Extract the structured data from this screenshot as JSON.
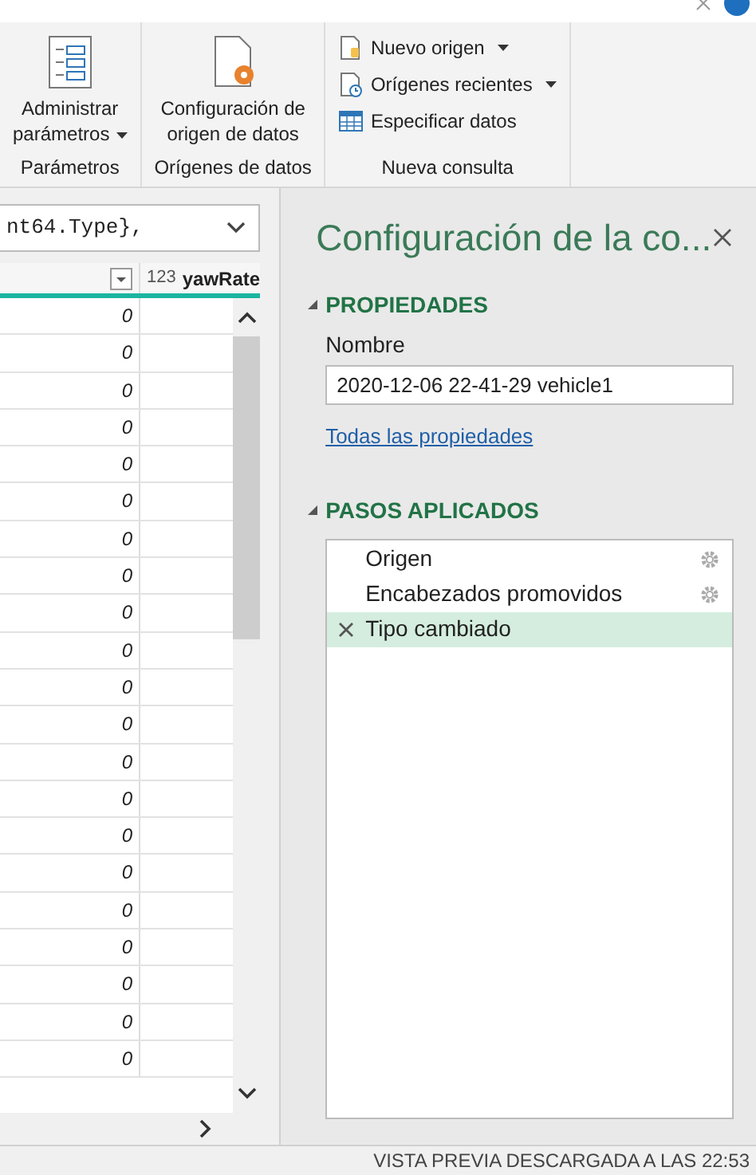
{
  "ribbon": {
    "groups": [
      {
        "label": "Parámetros",
        "buttons": [
          {
            "kind": "large",
            "lines": [
              "Administrar",
              "parámetros"
            ],
            "dropdown": true
          }
        ]
      },
      {
        "label": "Orígenes de datos",
        "buttons": [
          {
            "kind": "large",
            "lines": [
              "Configuración de",
              "origen de datos"
            ],
            "dropdown": false
          }
        ]
      },
      {
        "label": "Nueva consulta",
        "buttons": [
          {
            "kind": "small",
            "lines": [
              "Nuevo origen"
            ],
            "dropdown": true
          },
          {
            "kind": "small",
            "lines": [
              "Orígenes recientes"
            ],
            "dropdown": true
          },
          {
            "kind": "small",
            "lines": [
              "Especificar datos"
            ],
            "dropdown": false
          }
        ]
      }
    ]
  },
  "formula_bar": {
    "text": "nt64.Type},"
  },
  "table": {
    "columns": [
      {
        "filter": true
      },
      {
        "label": "yawRate",
        "type_icon": "123"
      }
    ],
    "rows": [
      [
        "0"
      ],
      [
        "0"
      ],
      [
        "0"
      ],
      [
        "0"
      ],
      [
        "0"
      ],
      [
        "0"
      ],
      [
        "0"
      ],
      [
        "0"
      ],
      [
        "0"
      ],
      [
        "0"
      ],
      [
        "0"
      ],
      [
        "0"
      ],
      [
        "0"
      ],
      [
        "0"
      ],
      [
        "0"
      ],
      [
        "0"
      ],
      [
        "0"
      ],
      [
        "0"
      ],
      [
        "0"
      ],
      [
        "0"
      ],
      [
        "0"
      ]
    ]
  },
  "query_settings": {
    "title": "Configuración de la co...",
    "properties": {
      "heading": "PROPIEDADES",
      "name_label": "Nombre",
      "name_value": "2020-12-06 22-41-29 vehicle1",
      "link": "Todas las propiedades"
    },
    "steps_heading": "PASOS APLICADOS",
    "steps": [
      {
        "label": "Origen",
        "selected": false,
        "settings": true
      },
      {
        "label": "Encabezados promovidos",
        "selected": false,
        "settings": true
      },
      {
        "label": "Tipo cambiado",
        "selected": true,
        "settings": false
      }
    ]
  },
  "status_bar": "VISTA PREVIA DESCARGADA A LAS 22:53"
}
